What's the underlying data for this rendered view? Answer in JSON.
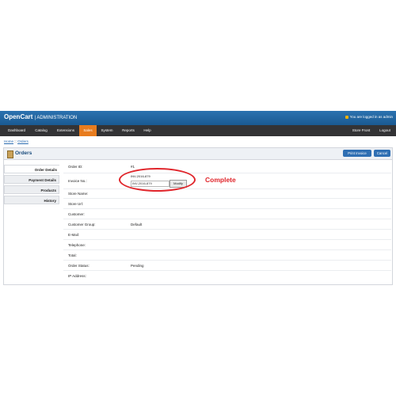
{
  "header": {
    "brand": "OpenCart",
    "brand_sub": "| ADMINISTRATION",
    "login_status": "You are logged in as admin"
  },
  "nav": {
    "items": [
      {
        "label": "Dashboard"
      },
      {
        "label": "Catalog"
      },
      {
        "label": "Extensions"
      },
      {
        "label": "Sales"
      },
      {
        "label": "System"
      },
      {
        "label": "Reports"
      },
      {
        "label": "Help"
      }
    ],
    "right_items": [
      {
        "label": "Store Front"
      },
      {
        "label": "Logout"
      }
    ],
    "active_color": "#e87c1e"
  },
  "breadcrumb": {
    "home": "Home",
    "separator": "::",
    "current": "Orders"
  },
  "panel": {
    "title": "Orders",
    "print_invoice_label": "Print Invoice",
    "cancel_label": "Cancel"
  },
  "tabs": [
    {
      "label": "Order Details"
    },
    {
      "label": "Payment Details"
    },
    {
      "label": "Products"
    },
    {
      "label": "History"
    }
  ],
  "fields": {
    "order_id": {
      "label": "Order ID:",
      "value": "#1"
    },
    "invoice_no": {
      "label": "Invoice No.:",
      "value": "INV-2016-879",
      "input_value": "INV-2016-879",
      "modify_label": "Modify"
    },
    "store_name": {
      "label": "Store Name:"
    },
    "store_url": {
      "label": "Store Url:"
    },
    "customer": {
      "label": "Customer:"
    },
    "customer_group": {
      "label": "Customer Group:",
      "value": "Default"
    },
    "email": {
      "label": "E-Mail:"
    },
    "telephone": {
      "label": "Telephone:"
    },
    "total": {
      "label": "Total:"
    },
    "order_status": {
      "label": "Order Status:",
      "value": "Pending"
    },
    "ip_address": {
      "label": "IP Address:"
    }
  },
  "annotation": {
    "text": "Complete",
    "color": "#e0252b"
  }
}
